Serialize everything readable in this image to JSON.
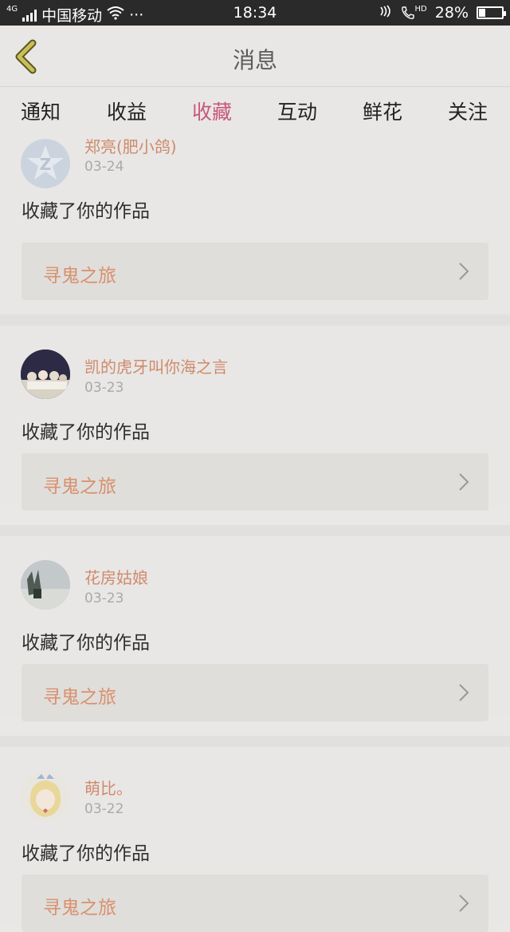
{
  "status_bar": {
    "network_type": "4G",
    "carrier": "中国移动",
    "more": "···",
    "time": "18:34",
    "hd_label": "HD",
    "battery_text": "28%",
    "battery_percent": 28
  },
  "navbar": {
    "title": "消息"
  },
  "tabs": [
    {
      "label": "通知",
      "active": false
    },
    {
      "label": "收益",
      "active": false
    },
    {
      "label": "收藏",
      "active": true
    },
    {
      "label": "互动",
      "active": false
    },
    {
      "label": "鲜花",
      "active": false
    },
    {
      "label": "关注",
      "active": false
    }
  ],
  "colors": {
    "accent": "#c9577a",
    "username": "#cf8a6c",
    "work_title": "#d9906d",
    "background": "#e8e7e5"
  },
  "feed": [
    {
      "username": "郑亮(肥小鸽)",
      "date": "03-24",
      "action": "收藏了你的作品",
      "work_title": "寻鬼之旅",
      "avatar": "default-star-avatar"
    },
    {
      "username": "凯的虎牙叫你海之言",
      "date": "03-23",
      "action": "收藏了你的作品",
      "work_title": "寻鬼之旅",
      "avatar": "group-photo-avatar"
    },
    {
      "username": "花房姑娘",
      "date": "03-23",
      "action": "收藏了你的作品",
      "work_title": "寻鬼之旅",
      "avatar": "landscape-photo-avatar"
    },
    {
      "username": "萌比。",
      "date": "03-22",
      "action": "收藏了你的作品",
      "work_title": "寻鬼之旅",
      "avatar": "anime-girl-avatar"
    }
  ]
}
